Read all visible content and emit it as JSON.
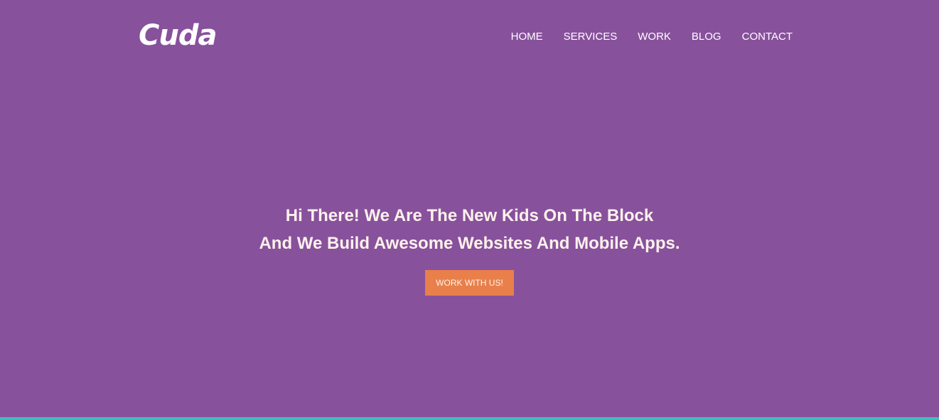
{
  "brand": {
    "name": "Cuda"
  },
  "nav": {
    "items": [
      {
        "label": "HOME"
      },
      {
        "label": "SERVICES"
      },
      {
        "label": "WORK"
      },
      {
        "label": "BLOG"
      },
      {
        "label": "CONTACT"
      }
    ]
  },
  "hero": {
    "line1": "Hi There! We Are The New Kids On The Block",
    "line2": "And We Build Awesome Websites And Mobile Apps.",
    "cta_label": "WORK WITH US!"
  },
  "colors": {
    "background": "#88519c",
    "cta": "#e97f4a",
    "accent_bar": "#3fbfb8",
    "text": "#ffffff"
  }
}
